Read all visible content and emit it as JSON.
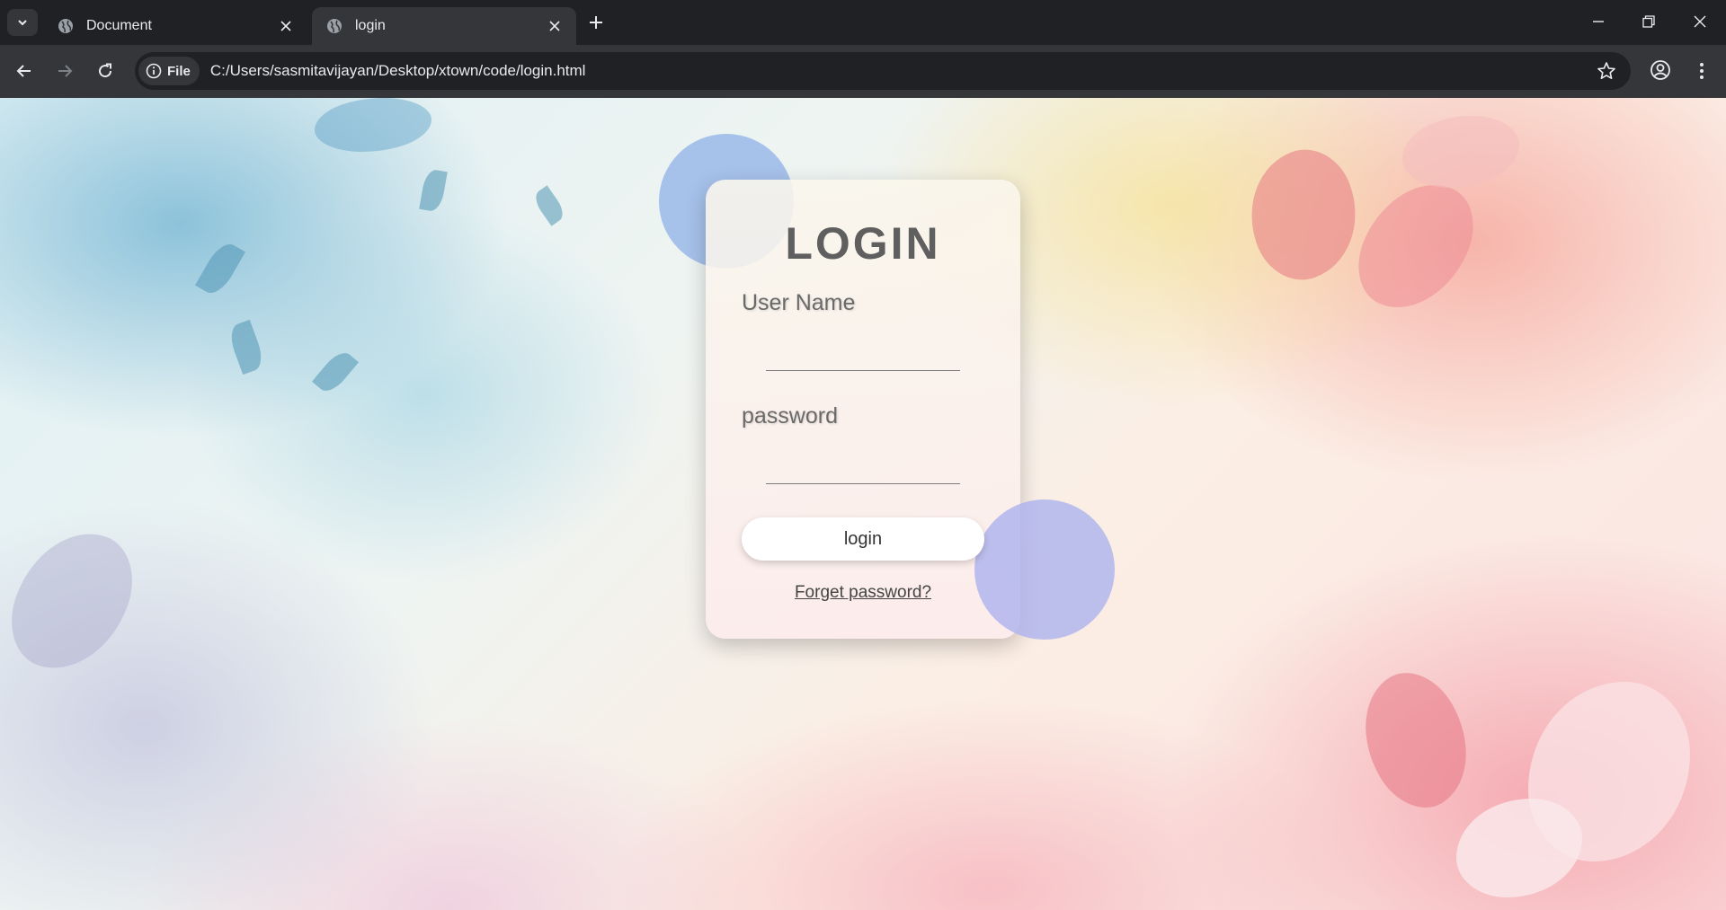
{
  "browser": {
    "tabs": [
      {
        "title": "Document",
        "active": false,
        "icon": "globe-icon"
      },
      {
        "title": "login",
        "active": true,
        "icon": "globe-icon"
      }
    ],
    "address_bar": {
      "chip_label": "File",
      "url": "C:/Users/sasmitavijayan/Desktop/xtown/code/login.html"
    }
  },
  "login_form": {
    "title": "LOGIN",
    "username_label": "User Name",
    "username_value": "",
    "password_label": "password",
    "password_value": "",
    "submit_label": "login",
    "forgot_link": "Forget password?"
  },
  "colors": {
    "chrome_dark": "#202124",
    "chrome_toolbar": "#35363a",
    "circle_top": "#96b6e8",
    "circle_bottom": "#acb2ee",
    "title_text": "#5f5f5f"
  }
}
